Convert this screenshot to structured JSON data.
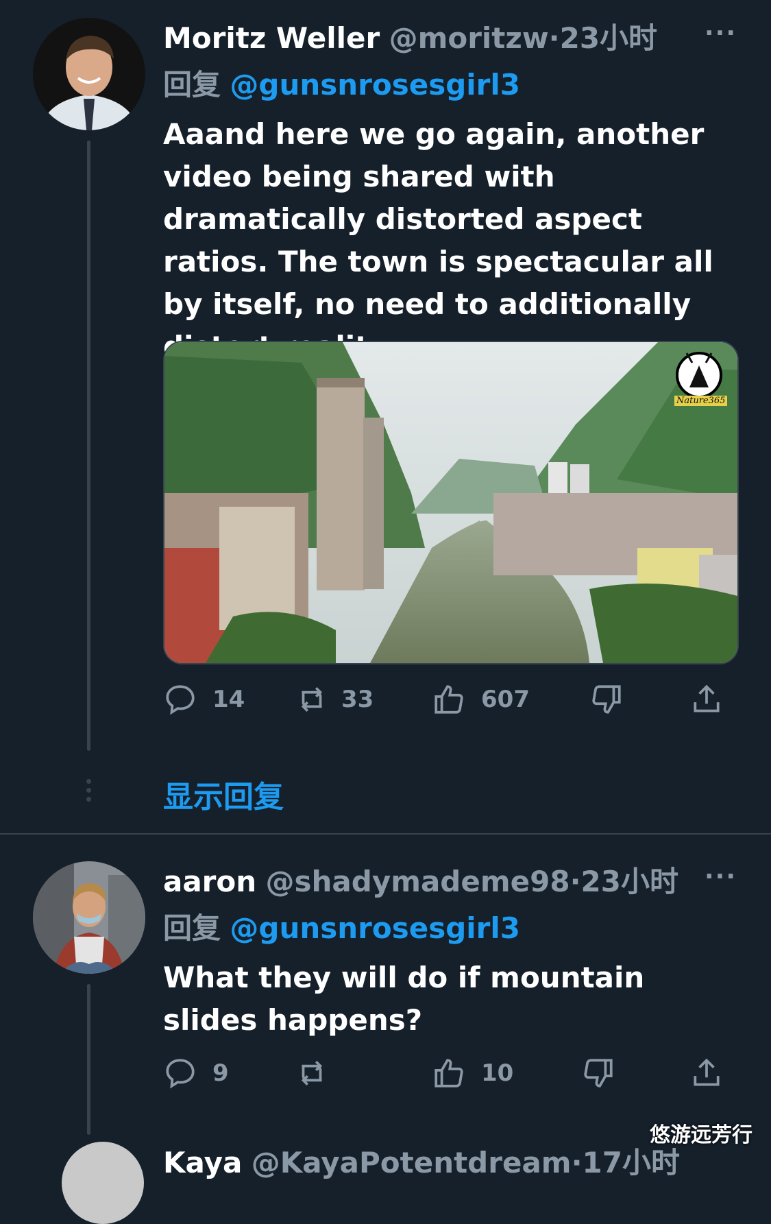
{
  "tweets": [
    {
      "name": "Moritz Weller",
      "handle": "@moritzw",
      "dot": "·",
      "time": "23小时",
      "more": "···",
      "reply_prefix": "回复",
      "reply_to": "@gunsnrosesgirl3",
      "text": "Aaand here we go again, another video being shared with dramatically distorted aspect ratios. The town is spectacular all by itself, no need to additionally distort reality.",
      "media_logo_text": "Nature365",
      "stats": {
        "replies": "14",
        "retweets": "33",
        "likes": "607"
      }
    },
    {
      "name": "aaron",
      "handle": "@shadymademe98",
      "dot": "·",
      "time": "23小时",
      "more": "···",
      "reply_prefix": "回复",
      "reply_to": "@gunsnrosesgirl3",
      "text": "What they will do if mountain slides happens?",
      "stats": {
        "replies": "9",
        "likes": "10"
      }
    },
    {
      "name": "Kaya",
      "handle": "@KayaPotentdream",
      "dot": "·",
      "time": "17小时"
    }
  ],
  "show_replies": "显示回复",
  "watermark": "悠游远芳行",
  "icons": {
    "reply": "reply-icon",
    "retweet": "retweet-icon",
    "like": "thumbs-up-icon",
    "dislike": "thumbs-down-icon",
    "share": "share-icon",
    "more": "more-icon"
  },
  "colors": {
    "background": "#15202b",
    "accent": "#1d9bf0",
    "muted": "#8b98a5",
    "divider": "#38444d"
  }
}
